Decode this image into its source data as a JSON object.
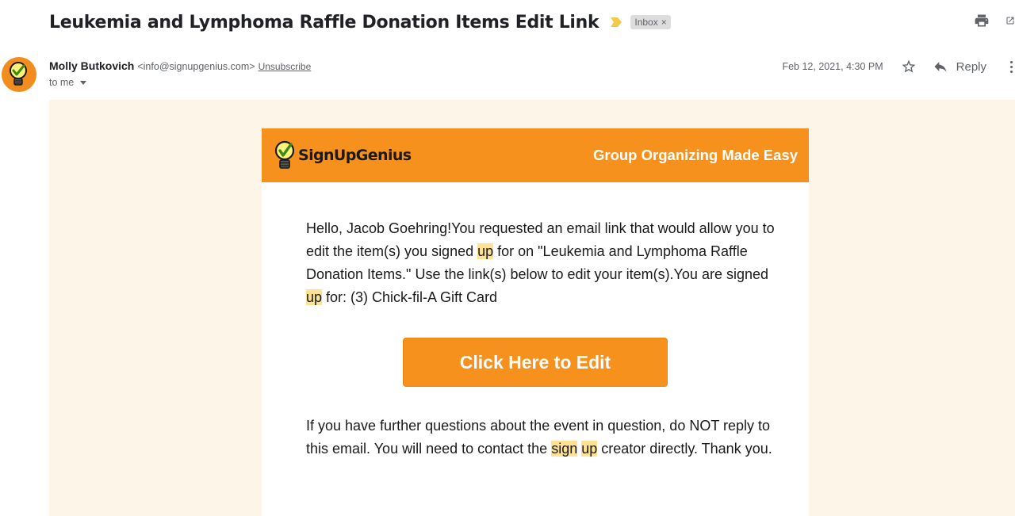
{
  "email": {
    "subject": "Leukemia and Lymphoma Raffle Donation Items Edit Link",
    "label_chip": "Inbox",
    "label_chip_close": "×",
    "sender_name": "Molly Butkovich",
    "sender_email": "<info@signupgenius.com>",
    "unsubscribe": "Unsubscribe",
    "recipient": "to me",
    "date": "Feb 12, 2021, 4:30 PM",
    "reply_label": "Reply"
  },
  "icons": {
    "importance": "importance-marker-icon",
    "print": "print-icon",
    "popout": "open-in-new-window-icon",
    "star": "star-icon",
    "reply": "reply-icon",
    "more": "more-vertical-icon",
    "avatar": "lightbulb-icon"
  },
  "message": {
    "brand": "SignUpGenius",
    "tagline": "Group Organizing Made Easy",
    "p1": [
      "Hello, Jacob Goehring!You requested an email link that would allow you to edit the item(s) you signed ",
      "up",
      " for on \"Leukemia and Lymphoma Raffle Donation Items.\" Use the link(s) below to edit your item(s).You are signed ",
      "up",
      " for: (3) Chick-fil-A Gift Card"
    ],
    "button_label": "Click Here to Edit",
    "p2": [
      "If you have further questions about the event in question, do NOT reply to this email. You will need to contact the ",
      "sign",
      " ",
      "up",
      " creator directly. Thank you."
    ]
  },
  "colors": {
    "brand_orange": "#f7911e",
    "email_background": "#fdf6e8",
    "search_highlight": "#fde293",
    "importance_yellow": "#f2c94c"
  }
}
